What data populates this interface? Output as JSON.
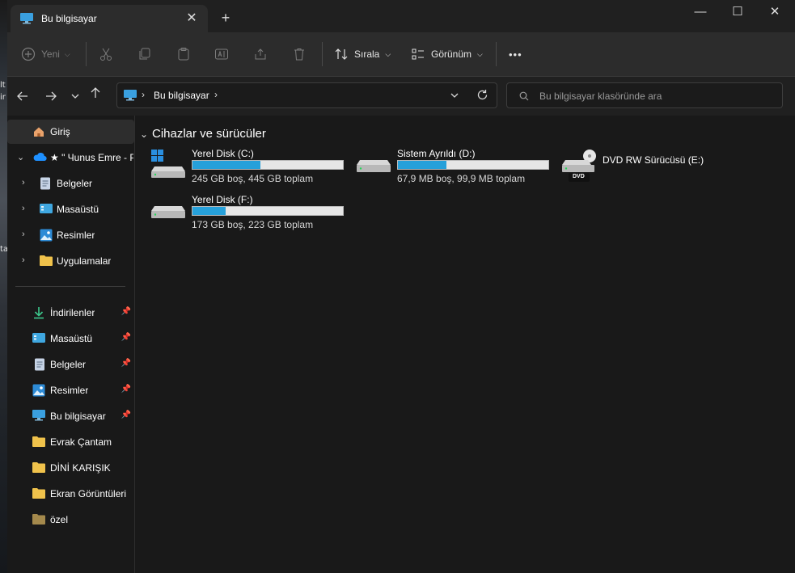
{
  "desktop_fragments": [
    "lt",
    "ir",
    "ta"
  ],
  "tab": {
    "title": "Bu bilgisayar",
    "close": "✕",
    "new": "+"
  },
  "window_controls": {
    "minimize": "—",
    "maximize": "☐",
    "close": "✕"
  },
  "toolbar": {
    "new_label": "Yeni",
    "sort_label": "Sırala",
    "view_label": "Görünüm",
    "more_label": "•••"
  },
  "address": {
    "path": "Bu bilgisayar"
  },
  "search": {
    "placeholder": "Bu bilgisayar klasöründe ara"
  },
  "sidebar": {
    "items": [
      {
        "label": "Giriş",
        "icon": "home-icon"
      },
      {
        "label": "★ \" Чunus Emre - P",
        "icon": "onedrive-icon"
      },
      {
        "label": "Belgeler",
        "icon": "documents-icon"
      },
      {
        "label": "Masaüstü",
        "icon": "desktop-icon"
      },
      {
        "label": "Resimler",
        "icon": "pictures-icon"
      },
      {
        "label": "Uygulamalar",
        "icon": "folder-icon"
      }
    ],
    "quick": [
      {
        "label": "İndirilenler",
        "icon": "download-icon"
      },
      {
        "label": "Masaüstü",
        "icon": "desktop-icon"
      },
      {
        "label": "Belgeler",
        "icon": "documents-icon"
      },
      {
        "label": "Resimler",
        "icon": "pictures-icon"
      },
      {
        "label": "Bu bilgisayar",
        "icon": "computer-icon"
      },
      {
        "label": "Evrak Çantam",
        "icon": "folder-icon"
      },
      {
        "label": "DİNİ KARIŞIK",
        "icon": "folder-icon"
      },
      {
        "label": "Ekran Görüntüleri",
        "icon": "folder-icon"
      },
      {
        "label": "özel",
        "icon": "folder-icon"
      }
    ]
  },
  "content": {
    "group_title": "Cihazlar ve sürücüler",
    "drives": [
      {
        "name": "Yerel Disk (C:)",
        "info": "245 GB boş, 445 GB toplam",
        "used_fraction": 0.45,
        "icon": "windows-drive-icon"
      },
      {
        "name": "Sistem Ayrıldı (D:)",
        "info": "67,9 MB boş, 99,9 MB toplam",
        "used_fraction": 0.32,
        "icon": "drive-icon"
      },
      {
        "name": "DVD RW Sürücüsü (E:)",
        "info": "",
        "icon": "dvd-drive-icon",
        "badge": "DVD"
      },
      {
        "name": "Yerel Disk (F:)",
        "info": "173 GB boş, 223 GB toplam",
        "used_fraction": 0.22,
        "icon": "drive-icon"
      }
    ]
  },
  "colors": {
    "accent": "#26a0da",
    "folder": "#f0c24b",
    "window_bg": "#191919"
  }
}
